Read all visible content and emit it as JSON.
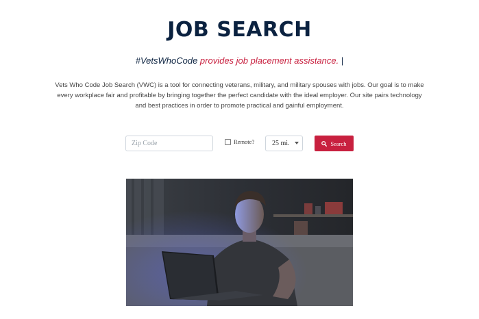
{
  "header": {
    "title": "JOB SEARCH",
    "tagline_hashtag": "#VetsWhoCode",
    "tagline_rest": " provides job placement assistance.",
    "tagline_cursor": " |"
  },
  "description": "Vets Who Code Job Search (VWC) is a tool for connecting veterans, military, and military spouses with jobs. Our goal is to make every workplace fair and profitable by bringing together the perfect candidate with the ideal employer. Our site pairs technology and best practices in order to promote practical and gainful employment.",
  "search": {
    "zip_placeholder": "Zip Code",
    "zip_value": "",
    "remote_label": "Remote?",
    "remote_checked": false,
    "distance_selected": "25 mi.",
    "button_label": "Search"
  },
  "colors": {
    "navy": "#0b2240",
    "accent_red": "#c8203f"
  },
  "icons": {
    "search_button_icon": "search-icon",
    "select_arrow": "chevron-down-icon"
  }
}
